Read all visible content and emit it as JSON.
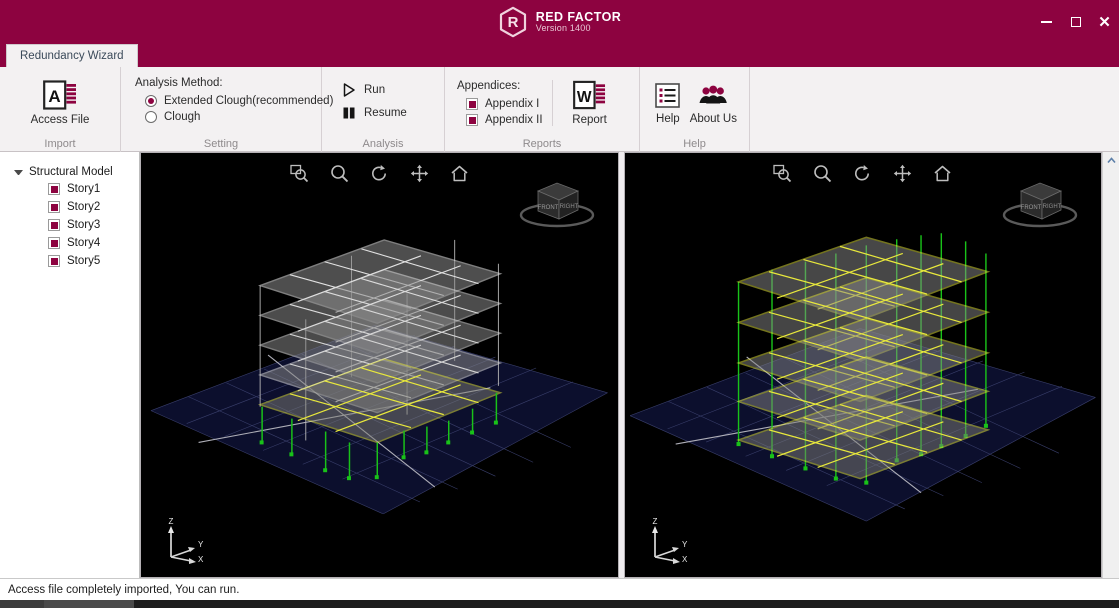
{
  "titlebar": {
    "brand_name": "RED FACTOR",
    "version": "Version 1400",
    "logo_letter": "R",
    "minimize_label": "",
    "maximize_label": "",
    "close_label": "✕"
  },
  "tabs": [
    {
      "label": "Redundancy Wizard",
      "active": true
    }
  ],
  "ribbon": {
    "groups": [
      {
        "title": "Import",
        "buttons": [
          {
            "label": "Access File",
            "icon": "access-file-icon"
          }
        ]
      },
      {
        "title": "Setting",
        "group_label": "Analysis Method:",
        "radios": [
          {
            "label": "Extended Clough(recommended)",
            "checked": true
          },
          {
            "label": "Clough",
            "checked": false
          }
        ]
      },
      {
        "title": "Analysis",
        "buttons": [
          {
            "label": "Run",
            "icon": "play-icon"
          },
          {
            "label": "Resume",
            "icon": "pause-icon"
          }
        ]
      },
      {
        "title": "Reports",
        "group_label": "Appendices:",
        "checks": [
          {
            "label": "Appendix I",
            "checked": true
          },
          {
            "label": "Appendix II",
            "checked": true
          }
        ],
        "buttons": [
          {
            "label": "Report",
            "icon": "word-report-icon"
          }
        ]
      },
      {
        "title": "Help",
        "buttons": [
          {
            "label": "Help",
            "icon": "help-list-icon"
          },
          {
            "label": "About Us",
            "icon": "about-us-people-icon"
          }
        ]
      }
    ]
  },
  "tree": {
    "root_label": "Structural Model",
    "items": [
      {
        "label": "Story1",
        "checked": true
      },
      {
        "label": "Story2",
        "checked": true
      },
      {
        "label": "Story3",
        "checked": true
      },
      {
        "label": "Story4",
        "checked": true
      },
      {
        "label": "Story5",
        "checked": true
      }
    ]
  },
  "viewports": [
    {
      "name": "left-model-view",
      "toolbar": [
        "zoom-window-icon",
        "zoom-icon",
        "rotate-icon",
        "pan-icon",
        "home-icon"
      ],
      "viewcube": {
        "face_front": "FRONT",
        "face_right": "RIGHT"
      },
      "axes": {
        "z": "Z",
        "y": "Y",
        "x": "X"
      }
    },
    {
      "name": "right-model-view",
      "toolbar": [
        "zoom-window-icon",
        "zoom-icon",
        "rotate-icon",
        "pan-icon",
        "home-icon"
      ],
      "viewcube": {
        "face_front": "FRONT",
        "face_right": "RIGHT"
      },
      "axes": {
        "z": "Z",
        "y": "Y",
        "x": "X"
      }
    }
  ],
  "statusbar": {
    "message": "Access file completely imported, You can run."
  },
  "colors": {
    "brand": "#8d0340",
    "ribbon_bg": "#f3f1f2",
    "viewport_bg": "#000000",
    "grid": "#2a2f55",
    "beam_highlight": "#e9e93a",
    "column_highlight": "#1ec81e",
    "frame_gray": "#cfcfcf"
  }
}
